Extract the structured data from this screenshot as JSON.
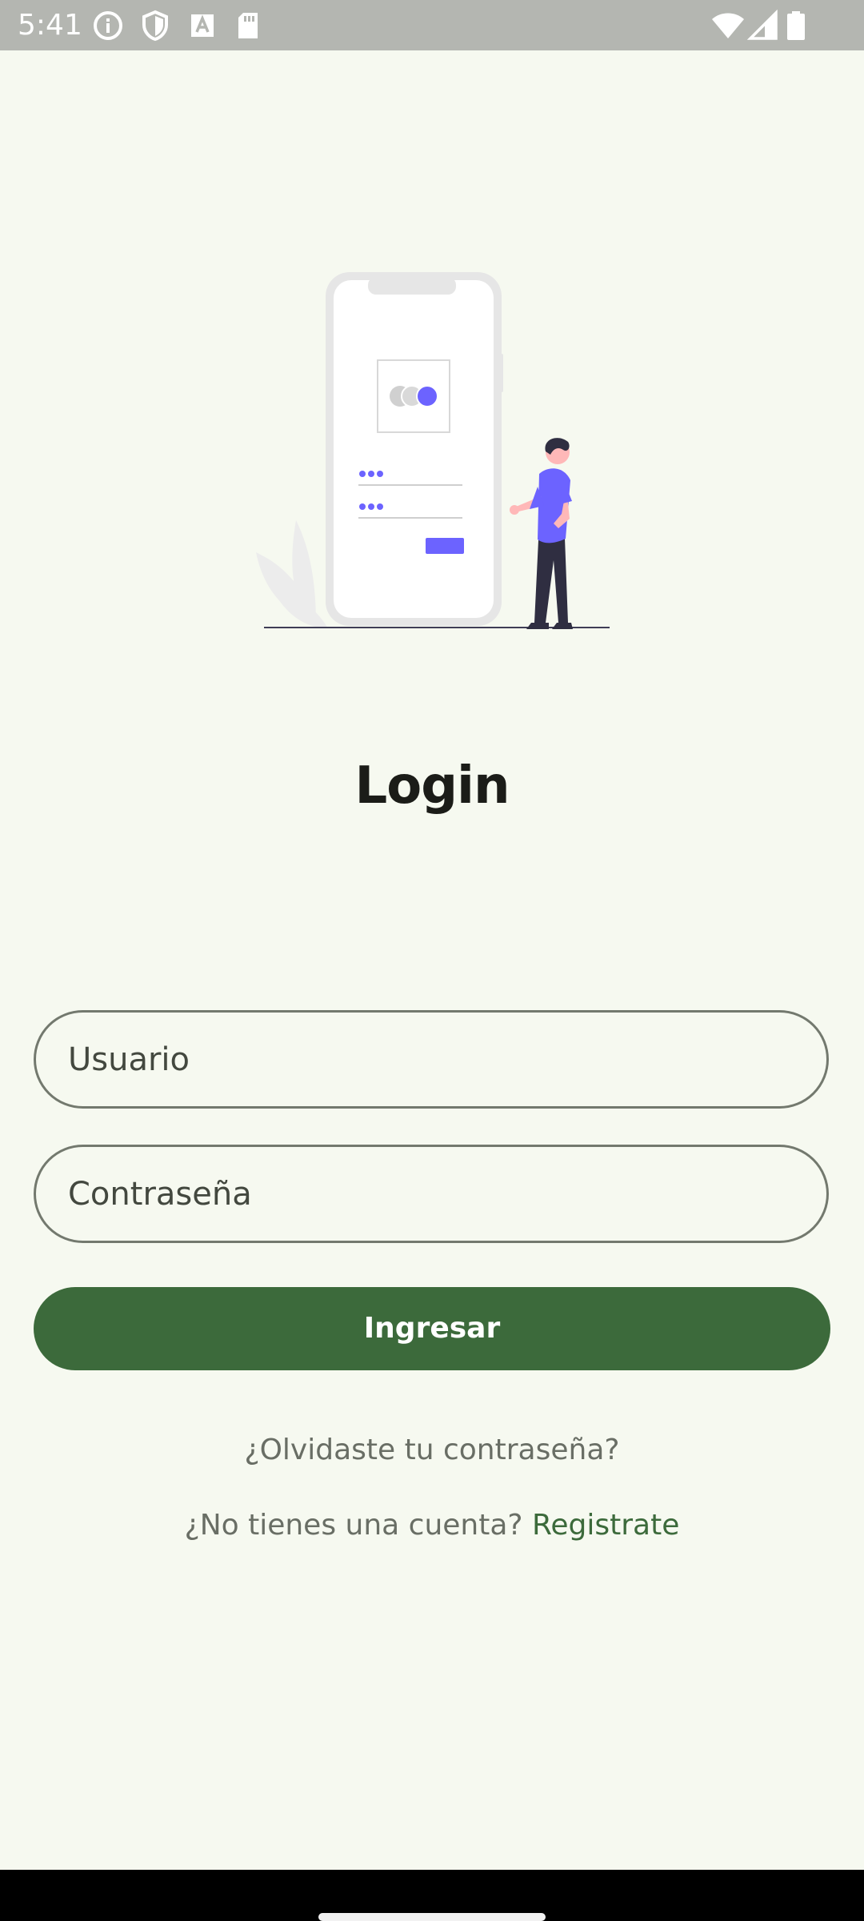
{
  "status_bar": {
    "time": "5:41",
    "left_icons": [
      "info-icon",
      "shield-icon",
      "a-box-icon",
      "sd-card-icon"
    ],
    "right_icons": [
      "wifi-icon",
      "signal-icon",
      "battery-icon"
    ]
  },
  "login": {
    "title": "Login",
    "username_placeholder": "Usuario",
    "password_placeholder": "Contraseña",
    "submit_label": "Ingresar",
    "forgot_password": "¿Olvidaste tu contraseña?",
    "no_account_text": "¿No tienes una cuenta?",
    "register_link": "Registrate"
  },
  "colors": {
    "background": "#f6f9f0",
    "primary": "#3c6a3b",
    "accent_illustration": "#6c63ff",
    "outline": "#73796e",
    "muted_text": "#696e65"
  }
}
